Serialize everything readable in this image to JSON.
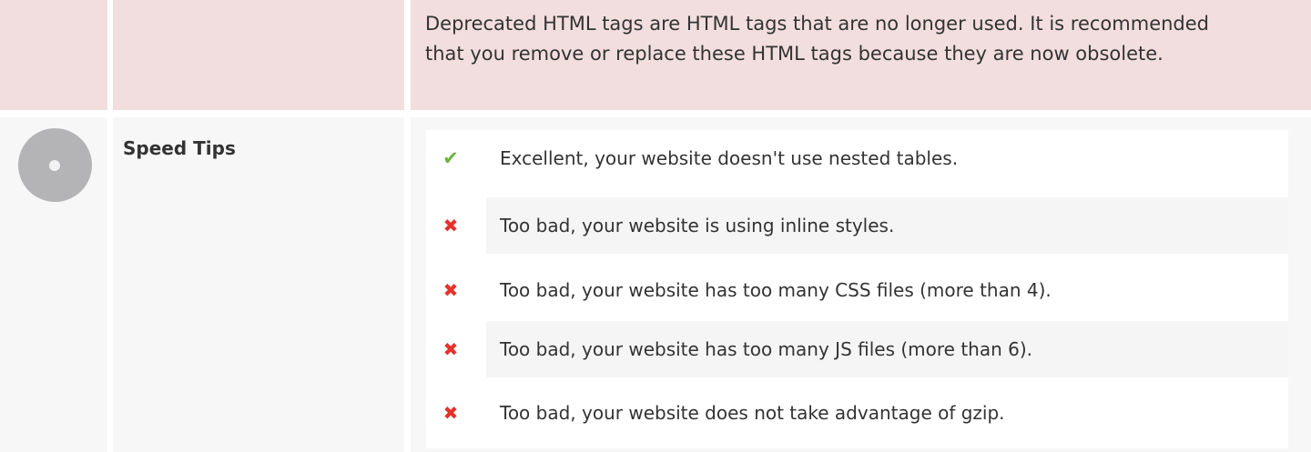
{
  "deprecated": {
    "description": "Deprecated HTML tags are HTML tags that are no longer used. It is recommended that you remove or replace these HTML tags because they are now obsolete."
  },
  "speed": {
    "title": "Speed Tips",
    "tips": [
      {
        "status": "pass",
        "icon": "check-icon",
        "glyph": "✔",
        "text": "Excellent, your website doesn't use nested tables."
      },
      {
        "status": "fail",
        "icon": "cross-icon",
        "glyph": "✖",
        "text": "Too bad, your website is using inline styles."
      },
      {
        "status": "fail",
        "icon": "cross-icon",
        "glyph": "✖",
        "text": "Too bad, your website has too many CSS files (more than 4)."
      },
      {
        "status": "fail",
        "icon": "cross-icon",
        "glyph": "✖",
        "text": "Too bad, your website has too many JS files (more than 6)."
      },
      {
        "status": "fail",
        "icon": "cross-icon",
        "glyph": "✖",
        "text": "Too bad, your website does not take advantage of gzip."
      }
    ]
  },
  "colors": {
    "warning_bg": "#f2dede",
    "neutral_bg": "#f7f7f7",
    "pass": "#6db33f",
    "fail": "#e5322d",
    "status_circle": "#b4b4b6"
  }
}
